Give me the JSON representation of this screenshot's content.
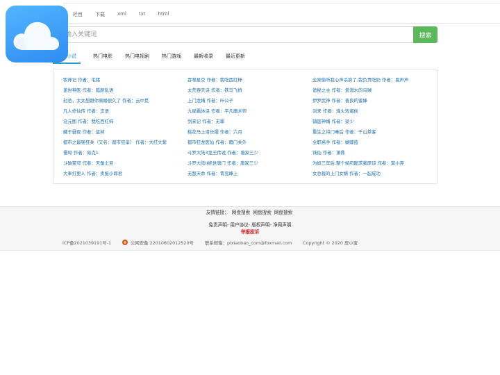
{
  "topnav": [
    "栏目",
    "下载",
    "xml",
    "txt",
    "html"
  ],
  "search": {
    "placeholder": "请输入关键词",
    "button": "搜索"
  },
  "tabs": [
    "热门小说",
    "热门电影",
    "热门电视剧",
    "热门游戏",
    "最新收录",
    "最近更新"
  ],
  "books": {
    "col1": [
      "牧神记 作者：宅猪",
      "盖世神医 作者：狐颜乱语",
      "封总，太太想跟你离婚很久了 作者：云中觅",
      "凡人修仙传 作者：忘语",
      "沧元图 作者：我吃西红柿",
      "藏于昼夜 作者：蓝掉",
      "都市之最强狂兵（又名：都市狂枭） 作者：大红大紫",
      "儒局 作者：易克1",
      "斗破苍穹 作者：天蚕土豆",
      "大奉打更人 作者：卖报小郎君"
    ],
    "col2": [
      "吞噬星空 作者：我吃西红柿",
      "太荒吞天诀 作者：铁马飞桥",
      "上门龙婿 作者：叶公子",
      "九星霸体诀 作者：平凡魔术师",
      "剑来记 作者：无罪",
      "桃花马上请长缨 作者：六月",
      "都市狂龙医仙 作者：雁门关外",
      "斗罗大陆3龙王传说 作者：唐家三少",
      "斗罗大陆II绝世唐门 作者：唐家三少",
      "无敌天命 作者：青鸾峰上"
    ],
    "col3": [
      "全家偷听我心声杀疯了,我负责吃奶 作者：夏声声",
      "诡秘之主 作者：爱潜水的乌贼",
      "伊罗武神 作者：善良的蜜蜂",
      "剑来 作者：烽火戏诸侯",
      "镇国神婿 作者：梁少",
      "重生之将门毒后 作者：千山茶客",
      "全职高手 作者：蝴蝶蓝",
      "诛仙 作者：萧鼎",
      "为奴三年后,整个侯府跪求我原谅 作者：莫小弃",
      "女总裁的上门女婿 作者：一起成功"
    ]
  },
  "footer": {
    "friends_label": "友情链接：",
    "friends": [
      "网盘搜索",
      "网盘搜索",
      "网盘搜索"
    ],
    "policy": "免责声明- 用户协议- 版权声明- 净网声明",
    "report": "举报投诉",
    "icp": "ICP备2021039191号-1",
    "police": "公网安备 22010602012520号",
    "email": "联系邮箱：pixiaobao_com@foxmail.com",
    "copyright": "Copyright © 2020 皮小宝"
  },
  "colors": {
    "accent": "#2d9ec7",
    "search_button": "#5cb85c",
    "logo": "#3c9cf5",
    "link": "#1a6fb3",
    "report": "#e02020"
  }
}
